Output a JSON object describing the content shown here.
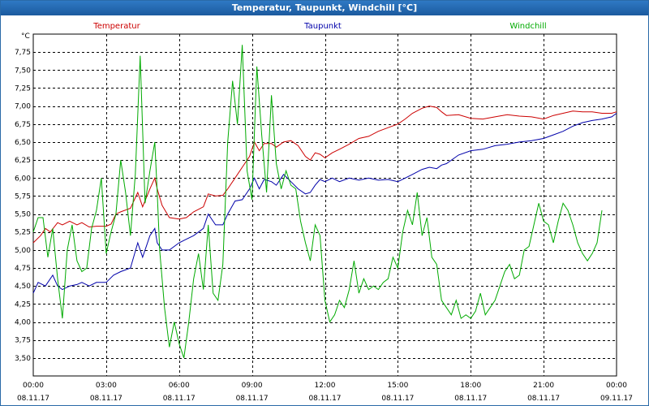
{
  "window": {
    "title": "Temperatur, Taupunkt, Windchill [°C]"
  },
  "chart_data": {
    "type": "line",
    "title": "Temperatur, Taupunkt, Windchill [°C]",
    "y_unit": "°C",
    "ylim": [
      3.25,
      8.0
    ],
    "y_ticks": [
      "3,50",
      "3,75",
      "4,00",
      "4,25",
      "4,50",
      "4,75",
      "5,00",
      "5,25",
      "5,50",
      "5,75",
      "6,00",
      "6,25",
      "6,50",
      "6,75",
      "7,00",
      "7,25",
      "7,50",
      "7,75"
    ],
    "y_tick_values": [
      3.5,
      3.75,
      4.0,
      4.25,
      4.5,
      4.75,
      5.0,
      5.25,
      5.5,
      5.75,
      6.0,
      6.25,
      6.5,
      6.75,
      7.0,
      7.25,
      7.5,
      7.75
    ],
    "xlim": [
      0,
      24
    ],
    "x_ticks": [
      {
        "hour": 0,
        "time": "00:00",
        "date": "08.11.17"
      },
      {
        "hour": 3,
        "time": "03:00",
        "date": "08.11.17"
      },
      {
        "hour": 6,
        "time": "06:00",
        "date": "08.11.17"
      },
      {
        "hour": 9,
        "time": "09:00",
        "date": "08.11.17"
      },
      {
        "hour": 12,
        "time": "12:00",
        "date": "08.11.17"
      },
      {
        "hour": 15,
        "time": "15:00",
        "date": "08.11.17"
      },
      {
        "hour": 18,
        "time": "18:00",
        "date": "08.11.17"
      },
      {
        "hour": 21,
        "time": "21:00",
        "date": "08.11.17"
      },
      {
        "hour": 24,
        "time": "00:00",
        "date": "09.11.17"
      }
    ],
    "grid": true,
    "legend_position": "top",
    "series": [
      {
        "name": "Temperatur",
        "color": "#cc0000",
        "points": [
          [
            0,
            5.1
          ],
          [
            0.3,
            5.2
          ],
          [
            0.5,
            5.3
          ],
          [
            0.7,
            5.25
          ],
          [
            1,
            5.38
          ],
          [
            1.2,
            5.35
          ],
          [
            1.5,
            5.4
          ],
          [
            1.8,
            5.35
          ],
          [
            2,
            5.38
          ],
          [
            2.3,
            5.32
          ],
          [
            2.6,
            5.33
          ],
          [
            3,
            5.33
          ],
          [
            3.2,
            5.36
          ],
          [
            3.4,
            5.5
          ],
          [
            3.6,
            5.53
          ],
          [
            4,
            5.58
          ],
          [
            4.3,
            5.8
          ],
          [
            4.5,
            5.6
          ],
          [
            4.8,
            5.85
          ],
          [
            5.0,
            6.0
          ],
          [
            5.1,
            5.85
          ],
          [
            5.3,
            5.62
          ],
          [
            5.6,
            5.45
          ],
          [
            6,
            5.43
          ],
          [
            6.3,
            5.45
          ],
          [
            6.6,
            5.53
          ],
          [
            7,
            5.6
          ],
          [
            7.2,
            5.78
          ],
          [
            7.5,
            5.75
          ],
          [
            7.8,
            5.76
          ],
          [
            8,
            5.85
          ],
          [
            8.3,
            6.0
          ],
          [
            8.6,
            6.15
          ],
          [
            8.9,
            6.3
          ],
          [
            9.1,
            6.5
          ],
          [
            9.3,
            6.38
          ],
          [
            9.5,
            6.48
          ],
          [
            9.8,
            6.48
          ],
          [
            10,
            6.43
          ],
          [
            10.3,
            6.5
          ],
          [
            10.6,
            6.52
          ],
          [
            10.9,
            6.45
          ],
          [
            11.2,
            6.3
          ],
          [
            11.4,
            6.25
          ],
          [
            11.6,
            6.35
          ],
          [
            11.8,
            6.33
          ],
          [
            12,
            6.28
          ],
          [
            12.3,
            6.35
          ],
          [
            12.6,
            6.4
          ],
          [
            13,
            6.47
          ],
          [
            13.4,
            6.55
          ],
          [
            13.8,
            6.58
          ],
          [
            14.2,
            6.65
          ],
          [
            14.6,
            6.7
          ],
          [
            15,
            6.75
          ],
          [
            15.3,
            6.82
          ],
          [
            15.6,
            6.9
          ],
          [
            16,
            6.97
          ],
          [
            16.3,
            7.0
          ],
          [
            16.6,
            6.98
          ],
          [
            16.8,
            6.92
          ],
          [
            17,
            6.87
          ],
          [
            17.5,
            6.88
          ],
          [
            18,
            6.83
          ],
          [
            18.5,
            6.82
          ],
          [
            19,
            6.85
          ],
          [
            19.5,
            6.88
          ],
          [
            20,
            6.86
          ],
          [
            20.5,
            6.85
          ],
          [
            21,
            6.82
          ],
          [
            21.4,
            6.87
          ],
          [
            21.8,
            6.9
          ],
          [
            22.2,
            6.93
          ],
          [
            22.6,
            6.92
          ],
          [
            23,
            6.92
          ],
          [
            23.4,
            6.9
          ],
          [
            23.8,
            6.9
          ],
          [
            24,
            6.92
          ]
        ]
      },
      {
        "name": "Taupunkt",
        "color": "#0000aa",
        "points": [
          [
            0,
            4.4
          ],
          [
            0.2,
            4.55
          ],
          [
            0.5,
            4.5
          ],
          [
            0.8,
            4.65
          ],
          [
            1.0,
            4.5
          ],
          [
            1.2,
            4.45
          ],
          [
            1.5,
            4.5
          ],
          [
            1.8,
            4.52
          ],
          [
            2.0,
            4.55
          ],
          [
            2.3,
            4.5
          ],
          [
            2.6,
            4.55
          ],
          [
            3.0,
            4.55
          ],
          [
            3.3,
            4.65
          ],
          [
            3.6,
            4.7
          ],
          [
            4.0,
            4.75
          ],
          [
            4.3,
            5.1
          ],
          [
            4.5,
            4.9
          ],
          [
            4.8,
            5.2
          ],
          [
            5.0,
            5.3
          ],
          [
            5.1,
            5.1
          ],
          [
            5.3,
            5.0
          ],
          [
            5.6,
            5.0
          ],
          [
            6.0,
            5.1
          ],
          [
            6.3,
            5.15
          ],
          [
            6.6,
            5.2
          ],
          [
            7.0,
            5.3
          ],
          [
            7.2,
            5.5
          ],
          [
            7.5,
            5.35
          ],
          [
            7.8,
            5.35
          ],
          [
            8.0,
            5.5
          ],
          [
            8.3,
            5.68
          ],
          [
            8.6,
            5.7
          ],
          [
            8.9,
            5.85
          ],
          [
            9.1,
            6.0
          ],
          [
            9.3,
            5.85
          ],
          [
            9.5,
            5.98
          ],
          [
            9.8,
            5.95
          ],
          [
            10.0,
            5.9
          ],
          [
            10.3,
            6.05
          ],
          [
            10.6,
            5.95
          ],
          [
            10.9,
            5.85
          ],
          [
            11.2,
            5.78
          ],
          [
            11.4,
            5.8
          ],
          [
            11.6,
            5.9
          ],
          [
            11.8,
            5.98
          ],
          [
            12.0,
            5.95
          ],
          [
            12.3,
            6.0
          ],
          [
            12.6,
            5.95
          ],
          [
            13.0,
            6.0
          ],
          [
            13.4,
            5.97
          ],
          [
            13.8,
            6.0
          ],
          [
            14.2,
            5.97
          ],
          [
            14.6,
            5.98
          ],
          [
            15.0,
            5.95
          ],
          [
            15.3,
            6.0
          ],
          [
            15.6,
            6.05
          ],
          [
            16.0,
            6.12
          ],
          [
            16.3,
            6.15
          ],
          [
            16.6,
            6.13
          ],
          [
            16.8,
            6.18
          ],
          [
            17.0,
            6.2
          ],
          [
            17.5,
            6.32
          ],
          [
            18.0,
            6.38
          ],
          [
            18.5,
            6.4
          ],
          [
            19.0,
            6.45
          ],
          [
            19.5,
            6.47
          ],
          [
            20.0,
            6.5
          ],
          [
            20.5,
            6.52
          ],
          [
            21.0,
            6.55
          ],
          [
            21.4,
            6.6
          ],
          [
            21.8,
            6.65
          ],
          [
            22.2,
            6.72
          ],
          [
            22.6,
            6.77
          ],
          [
            23.0,
            6.8
          ],
          [
            23.4,
            6.82
          ],
          [
            23.8,
            6.85
          ],
          [
            24.0,
            6.9
          ]
        ]
      },
      {
        "name": "Windchill",
        "color": "#00aa00",
        "points": [
          [
            0,
            5.25
          ],
          [
            0.2,
            5.45
          ],
          [
            0.4,
            5.45
          ],
          [
            0.6,
            4.9
          ],
          [
            0.8,
            5.3
          ],
          [
            1.0,
            4.6
          ],
          [
            1.2,
            4.05
          ],
          [
            1.4,
            5.0
          ],
          [
            1.6,
            5.35
          ],
          [
            1.8,
            4.85
          ],
          [
            2.0,
            4.7
          ],
          [
            2.2,
            4.75
          ],
          [
            2.4,
            5.3
          ],
          [
            2.6,
            5.55
          ],
          [
            2.8,
            6.0
          ],
          [
            3.0,
            4.95
          ],
          [
            3.2,
            5.25
          ],
          [
            3.4,
            5.5
          ],
          [
            3.6,
            6.25
          ],
          [
            3.8,
            5.8
          ],
          [
            4.0,
            5.2
          ],
          [
            4.2,
            6.05
          ],
          [
            4.4,
            7.7
          ],
          [
            4.6,
            5.65
          ],
          [
            4.8,
            6.1
          ],
          [
            5.0,
            6.5
          ],
          [
            5.1,
            5.8
          ],
          [
            5.2,
            5.0
          ],
          [
            5.4,
            4.2
          ],
          [
            5.6,
            3.65
          ],
          [
            5.8,
            4.0
          ],
          [
            6.0,
            3.7
          ],
          [
            6.2,
            3.5
          ],
          [
            6.4,
            4.0
          ],
          [
            6.6,
            4.6
          ],
          [
            6.8,
            4.95
          ],
          [
            7.0,
            4.45
          ],
          [
            7.2,
            5.35
          ],
          [
            7.4,
            4.4
          ],
          [
            7.6,
            4.3
          ],
          [
            7.8,
            4.8
          ],
          [
            8.0,
            6.5
          ],
          [
            8.2,
            7.35
          ],
          [
            8.4,
            6.75
          ],
          [
            8.6,
            7.85
          ],
          [
            8.8,
            6.1
          ],
          [
            9.0,
            5.7
          ],
          [
            9.2,
            7.55
          ],
          [
            9.4,
            6.6
          ],
          [
            9.6,
            5.8
          ],
          [
            9.8,
            7.15
          ],
          [
            10.0,
            6.2
          ],
          [
            10.2,
            5.85
          ],
          [
            10.4,
            6.1
          ],
          [
            10.6,
            5.9
          ],
          [
            10.8,
            5.85
          ],
          [
            11.0,
            5.4
          ],
          [
            11.2,
            5.1
          ],
          [
            11.4,
            4.85
          ],
          [
            11.6,
            5.35
          ],
          [
            11.8,
            5.2
          ],
          [
            12.0,
            4.3
          ],
          [
            12.2,
            4.0
          ],
          [
            12.4,
            4.1
          ],
          [
            12.6,
            4.3
          ],
          [
            12.8,
            4.2
          ],
          [
            13.0,
            4.45
          ],
          [
            13.2,
            4.85
          ],
          [
            13.4,
            4.4
          ],
          [
            13.6,
            4.6
          ],
          [
            13.8,
            4.45
          ],
          [
            14.0,
            4.5
          ],
          [
            14.2,
            4.45
          ],
          [
            14.4,
            4.55
          ],
          [
            14.6,
            4.6
          ],
          [
            14.8,
            4.9
          ],
          [
            15.0,
            4.75
          ],
          [
            15.2,
            5.25
          ],
          [
            15.4,
            5.55
          ],
          [
            15.6,
            5.35
          ],
          [
            15.8,
            5.8
          ],
          [
            16.0,
            5.2
          ],
          [
            16.2,
            5.45
          ],
          [
            16.4,
            4.9
          ],
          [
            16.6,
            4.8
          ],
          [
            16.8,
            4.3
          ],
          [
            17.0,
            4.2
          ],
          [
            17.2,
            4.1
          ],
          [
            17.4,
            4.3
          ],
          [
            17.6,
            4.05
          ],
          [
            17.8,
            4.1
          ],
          [
            18.0,
            4.05
          ],
          [
            18.2,
            4.15
          ],
          [
            18.4,
            4.4
          ],
          [
            18.6,
            4.1
          ],
          [
            18.8,
            4.2
          ],
          [
            19.0,
            4.3
          ],
          [
            19.2,
            4.5
          ],
          [
            19.4,
            4.7
          ],
          [
            19.6,
            4.8
          ],
          [
            19.8,
            4.6
          ],
          [
            20.0,
            4.65
          ],
          [
            20.2,
            5.0
          ],
          [
            20.4,
            5.05
          ],
          [
            20.6,
            5.35
          ],
          [
            20.8,
            5.65
          ],
          [
            21.0,
            5.4
          ],
          [
            21.2,
            5.35
          ],
          [
            21.4,
            5.1
          ],
          [
            21.6,
            5.4
          ],
          [
            21.8,
            5.65
          ],
          [
            22.0,
            5.55
          ],
          [
            22.2,
            5.35
          ],
          [
            22.4,
            5.1
          ],
          [
            22.6,
            4.95
          ],
          [
            22.8,
            4.85
          ],
          [
            23.0,
            4.95
          ],
          [
            23.2,
            5.1
          ],
          [
            23.4,
            5.55
          ]
        ]
      }
    ]
  }
}
